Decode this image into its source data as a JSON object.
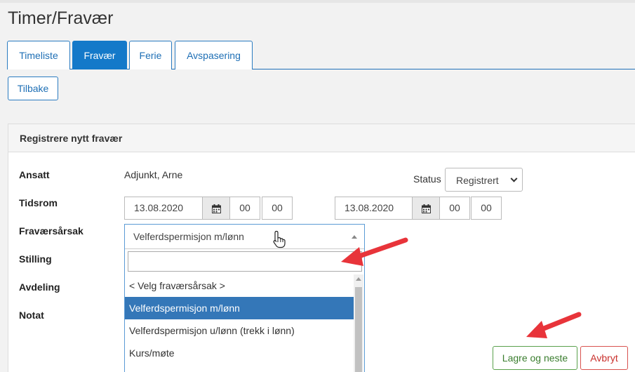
{
  "page": {
    "title": "Timer/Fravær"
  },
  "tabs": [
    {
      "label": "Timeliste",
      "active": false
    },
    {
      "label": "Fravær",
      "active": true
    },
    {
      "label": "Ferie",
      "active": false
    },
    {
      "label": "Avspasering",
      "active": false
    }
  ],
  "back_button": "Tilbake",
  "panel": {
    "title": "Registrere nytt fravær"
  },
  "form": {
    "employee_label": "Ansatt",
    "employee_value": "Adjunkt, Arne",
    "period_label": "Tidsrom",
    "reason_label": "Fraværsårsak",
    "position_label": "Stilling",
    "department_label": "Avdeling",
    "note_label": "Notat",
    "status_label": "Status",
    "status_value": "Registrert",
    "from": {
      "date": "13.08.2020",
      "hour": "00",
      "minute": "00"
    },
    "to": {
      "date": "13.08.2020",
      "hour": "00",
      "minute": "00"
    }
  },
  "reason_dropdown": {
    "selected": "Velferdspermisjon m/lønn",
    "search_value": "",
    "options": [
      "< Velg fraværsårsak >",
      "Velferdspermisjon m/lønn",
      "Velferdspermisjon u/lønn (trekk i lønn)",
      "Kurs/møte"
    ],
    "highlighted_index": 1
  },
  "actions": {
    "save_next": "Lagre og neste",
    "cancel": "Avbryt"
  },
  "colors": {
    "primary": "#1479c9",
    "highlight": "#3477b8",
    "success": "#5aa14c",
    "danger": "#d9534f",
    "annotation_arrow": "#e8343a"
  }
}
